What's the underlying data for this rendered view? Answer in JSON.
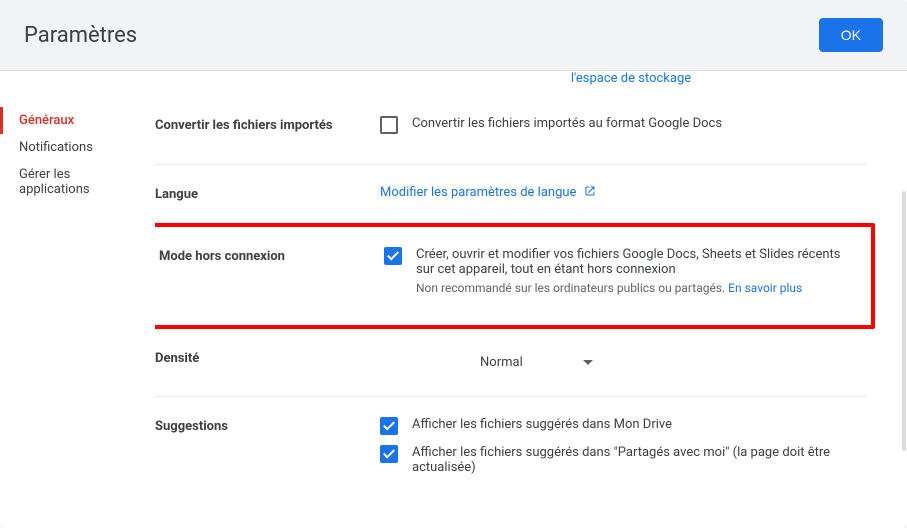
{
  "header": {
    "title": "Paramètres",
    "ok_label": "OK"
  },
  "sidebar": {
    "items": [
      {
        "label": "Généraux"
      },
      {
        "label": "Notifications"
      },
      {
        "label": "Gérer les applications"
      }
    ]
  },
  "storage": {
    "link": "l'espace de stockage"
  },
  "convert": {
    "label": "Convertir les fichiers importés",
    "option": "Convertir les fichiers importés au format Google Docs"
  },
  "language": {
    "label": "Langue",
    "link": "Modifier les paramètres de langue"
  },
  "offline": {
    "label": "Mode hors connexion",
    "desc": "Créer, ouvrir et modifier vos fichiers Google Docs, Sheets et Slides récents sur cet appareil, tout en étant hors connexion",
    "note": "Non recommandé sur les ordinateurs publics ou partagés. ",
    "learn_more": "En savoir plus"
  },
  "density": {
    "label": "Densité",
    "value": "Normal"
  },
  "suggestions": {
    "label": "Suggestions",
    "opt1": "Afficher les fichiers suggérés dans Mon Drive",
    "opt2": "Afficher les fichiers suggérés dans \"Partagés avec moi\" (la page doit être actualisée)"
  }
}
